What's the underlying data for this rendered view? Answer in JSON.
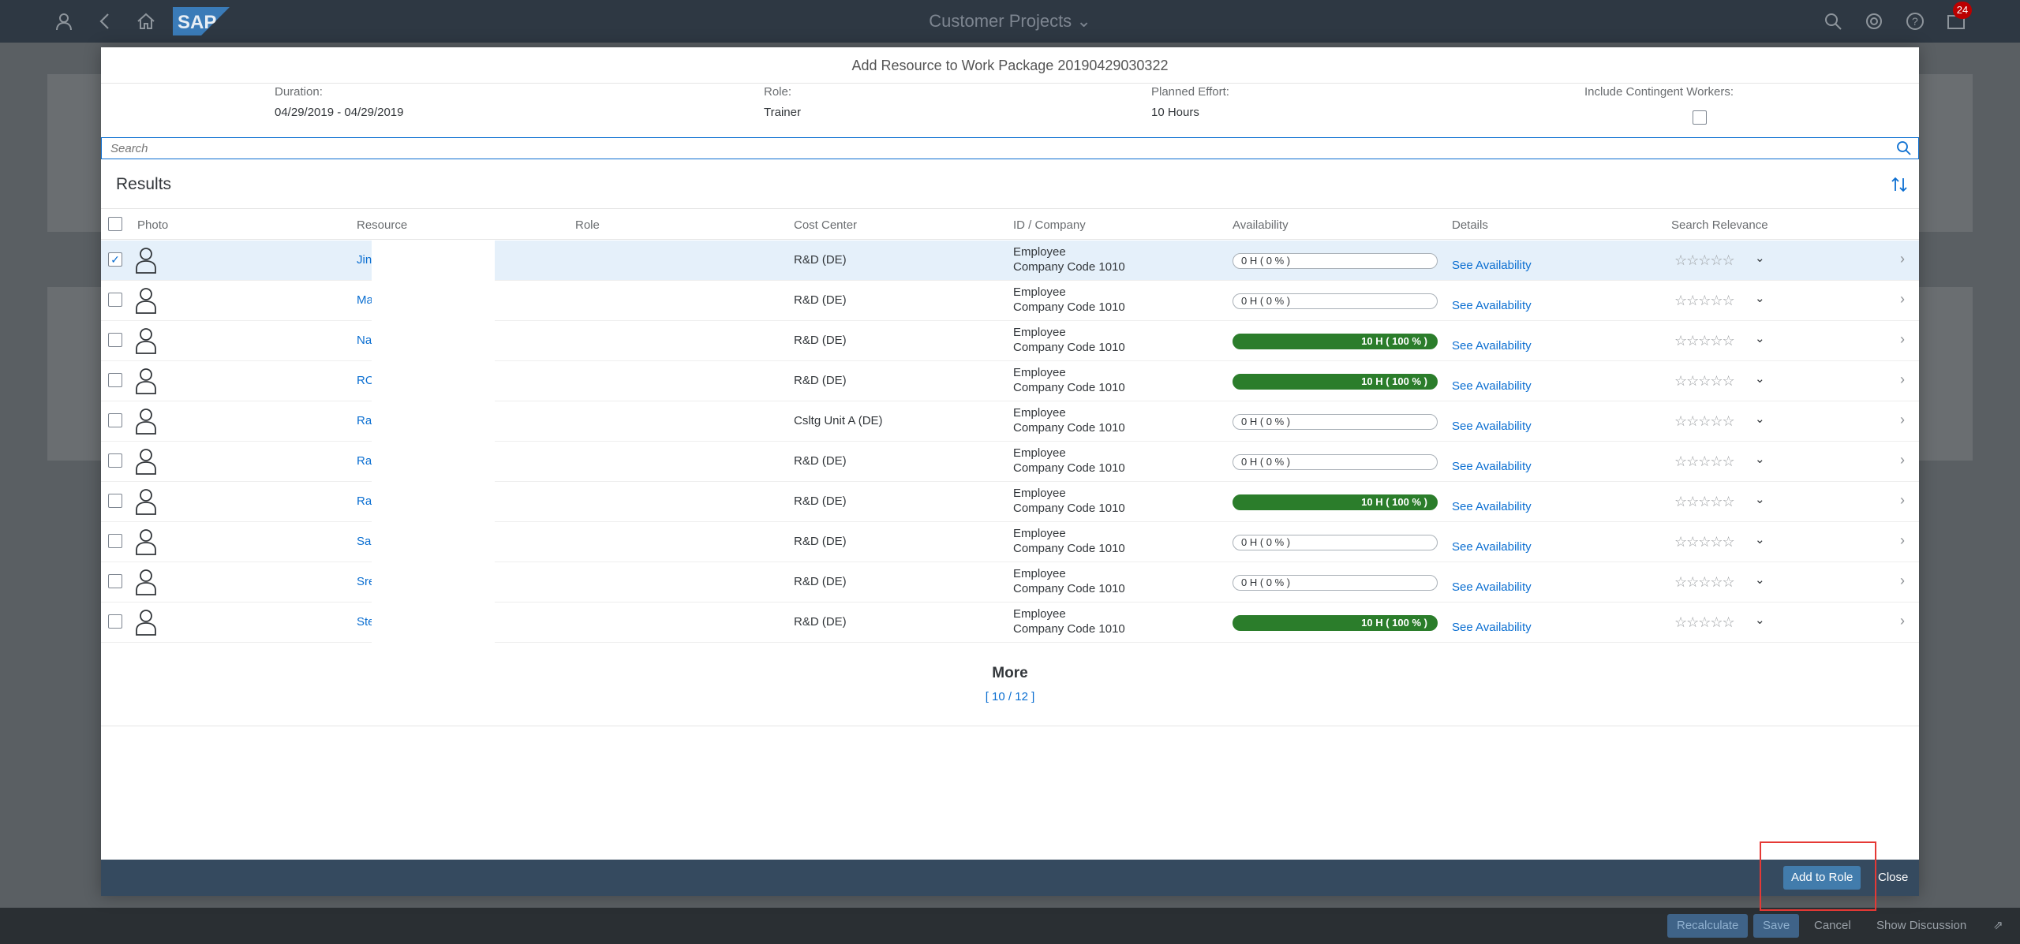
{
  "shell": {
    "title": "Customer Projects",
    "title_chevron": "⌄",
    "notification_count": "24",
    "logo_text": "SAP",
    "icons": [
      "user-icon",
      "back-icon",
      "home-icon",
      "search-icon",
      "sync-icon",
      "help-icon",
      "notifications-icon"
    ]
  },
  "background_footer": {
    "recalculate": "Recalculate",
    "save": "Save",
    "cancel": "Cancel",
    "show_discussion": "Show Discussion"
  },
  "dialog": {
    "title": "Add Resource to Work Package 20190429030322",
    "info": {
      "duration_label": "Duration:",
      "duration_value": "04/29/2019 - 04/29/2019",
      "role_label": "Role:",
      "role_value": "Trainer",
      "effort_label": "Planned Effort:",
      "effort_value": "10 Hours",
      "contingent_label": "Include Contingent Workers:"
    },
    "search": {
      "placeholder": "Search"
    },
    "results_title": "Results",
    "columns": {
      "photo": "Photo",
      "resource": "Resource",
      "role": "Role",
      "cost_center": "Cost Center",
      "id_company": "ID / Company",
      "availability": "Availability",
      "details": "Details",
      "search_relevance": "Search Relevance"
    },
    "rows": [
      {
        "resource": "Jin",
        "cost_center": "R&D (DE)",
        "id_line1": "Employee",
        "id_line2": "Company Code 1010",
        "availability": "0 H ( 0 % )",
        "availability_pct": 0,
        "details": "See Availability",
        "stars": "☆☆☆☆☆",
        "selected": true
      },
      {
        "resource": "Ma",
        "cost_center": "R&D (DE)",
        "id_line1": "Employee",
        "id_line2": "Company Code 1010",
        "availability": "0 H ( 0 % )",
        "availability_pct": 0,
        "details": "See Availability",
        "stars": "☆☆☆☆☆",
        "selected": false
      },
      {
        "resource": "Na",
        "cost_center": "R&D (DE)",
        "id_line1": "Employee",
        "id_line2": "Company Code 1010",
        "availability": "10 H ( 100 % )",
        "availability_pct": 100,
        "details": "See Availability",
        "stars": "☆☆☆☆☆",
        "selected": false
      },
      {
        "resource": "RO",
        "cost_center": "R&D (DE)",
        "id_line1": "Employee",
        "id_line2": "Company Code 1010",
        "availability": "10 H ( 100 % )",
        "availability_pct": 100,
        "details": "See Availability",
        "stars": "☆☆☆☆☆",
        "selected": false
      },
      {
        "resource": "Ra",
        "cost_center": "Csltg Unit A (DE)",
        "id_line1": "Employee",
        "id_line2": "Company Code 1010",
        "availability": "0 H ( 0 % )",
        "availability_pct": 0,
        "details": "See Availability",
        "stars": "☆☆☆☆☆",
        "selected": false
      },
      {
        "resource": "Ra",
        "cost_center": "R&D (DE)",
        "id_line1": "Employee",
        "id_line2": "Company Code 1010",
        "availability": "0 H ( 0 % )",
        "availability_pct": 0,
        "details": "See Availability",
        "stars": "☆☆☆☆☆",
        "selected": false
      },
      {
        "resource": "Ra",
        "cost_center": "R&D (DE)",
        "id_line1": "Employee",
        "id_line2": "Company Code 1010",
        "availability": "10 H ( 100 % )",
        "availability_pct": 100,
        "details": "See Availability",
        "stars": "☆☆☆☆☆",
        "selected": false
      },
      {
        "resource": "Sa",
        "cost_center": "R&D (DE)",
        "id_line1": "Employee",
        "id_line2": "Company Code 1010",
        "availability": "0 H ( 0 % )",
        "availability_pct": 0,
        "details": "See Availability",
        "stars": "☆☆☆☆☆",
        "selected": false
      },
      {
        "resource": "Sre",
        "cost_center": "R&D (DE)",
        "id_line1": "Employee",
        "id_line2": "Company Code 1010",
        "availability": "0 H ( 0 % )",
        "availability_pct": 0,
        "details": "See Availability",
        "stars": "☆☆☆☆☆",
        "selected": false
      },
      {
        "resource": "Ste",
        "cost_center": "R&D (DE)",
        "id_line1": "Employee",
        "id_line2": "Company Code 1010",
        "availability": "10 H ( 100 % )",
        "availability_pct": 100,
        "details": "See Availability",
        "stars": "☆☆☆☆☆",
        "selected": false
      }
    ],
    "more_label": "More",
    "more_count": "[ 10 / 12 ]",
    "footer": {
      "add_to_role": "Add to Role",
      "close": "Close"
    }
  },
  "colors": {
    "accent": "#0a6ed1",
    "availability_full": "#2b7d2b",
    "footer_bar": "#354a5f",
    "highlight": "#e53935"
  }
}
